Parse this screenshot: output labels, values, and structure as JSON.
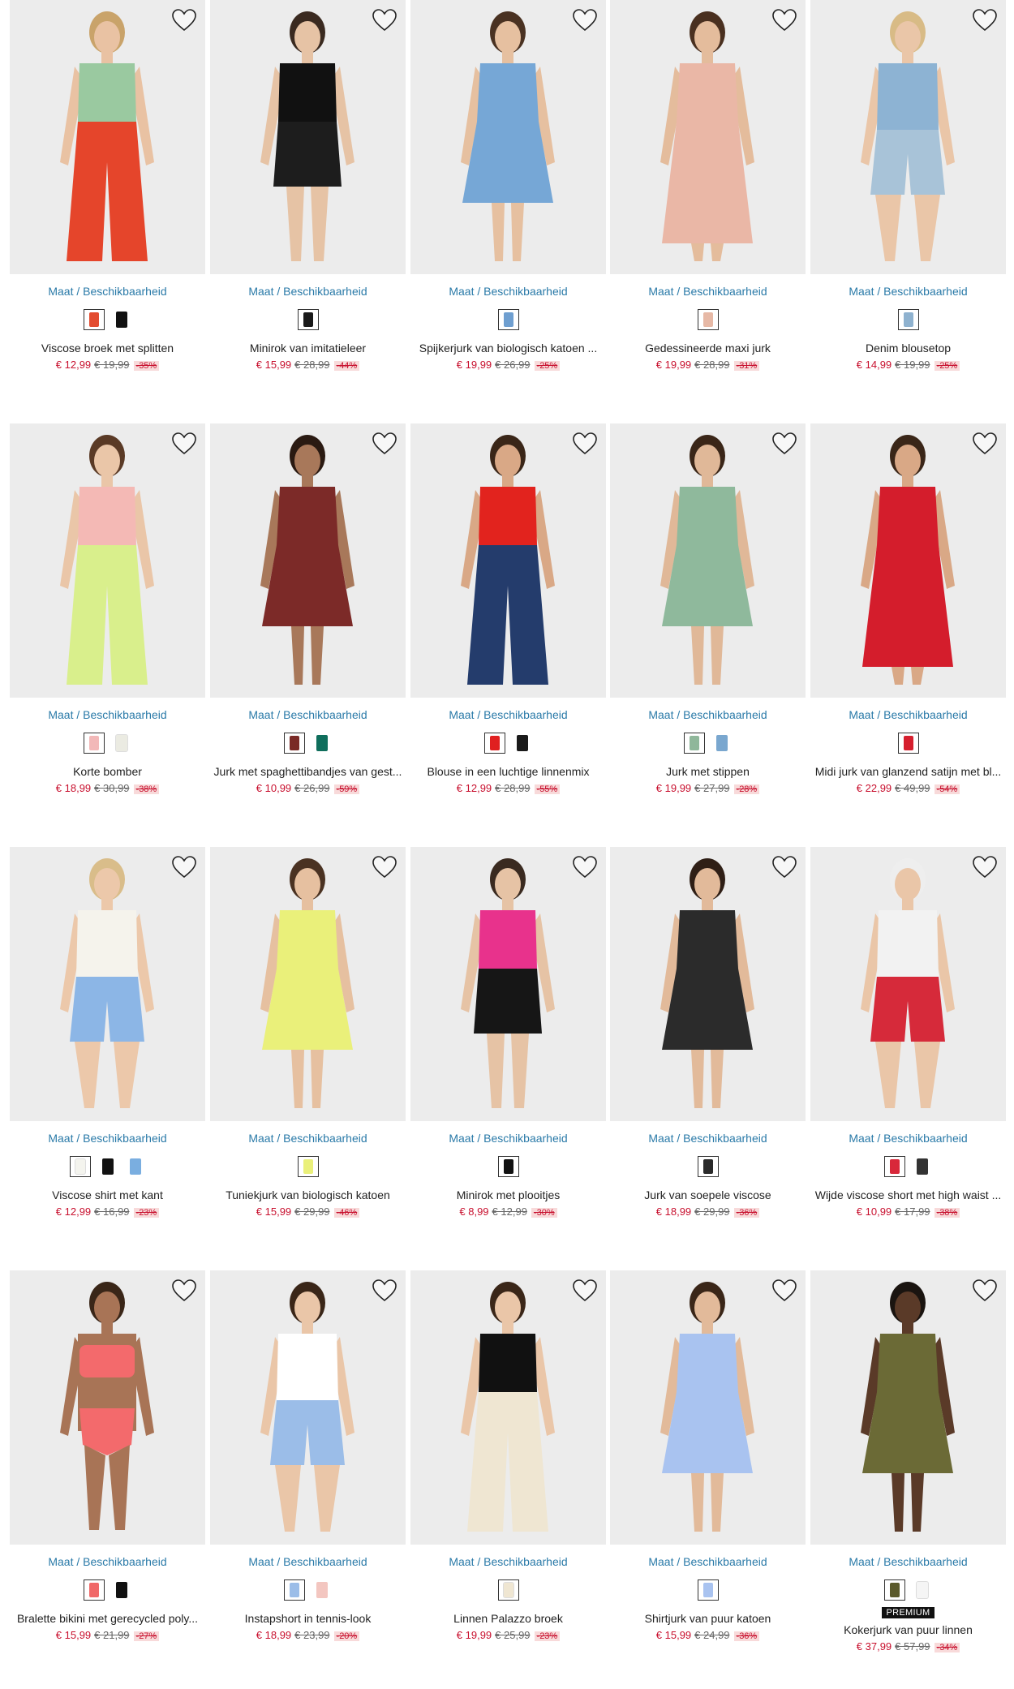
{
  "size_link_label": "Maat / Beschikbaarheid",
  "products": [
    {
      "name": "Viscose broek met splitten",
      "price": "€ 12,99",
      "old_price": "€ 19,99",
      "discount": "-35%",
      "swatches": [
        "#e34b2f",
        "#111111"
      ],
      "badge": "",
      "figure": {
        "top": "#9ac9a0",
        "bottom": "#e5452b",
        "skin": "#e9c2a3",
        "hair": "#c9a36a",
        "style": "pants"
      }
    },
    {
      "name": "Minirok van imitatieleer",
      "price": "€ 15,99",
      "old_price": "€ 28,99",
      "discount": "-44%",
      "swatches": [
        "#1a1a1a"
      ],
      "badge": "",
      "figure": {
        "top": "#111111",
        "bottom": "#1d1d1d",
        "skin": "#e6c3a5",
        "hair": "#3a2a20",
        "style": "skirt"
      }
    },
    {
      "name": "Spijkerjurk van biologisch katoen ...",
      "price": "€ 19,99",
      "old_price": "€ 26,99",
      "discount": "-25%",
      "swatches": [
        "#6f9fd0"
      ],
      "badge": "",
      "figure": {
        "top": "#76a7d6",
        "bottom": "#76a7d6",
        "skin": "#e6c0a0",
        "hair": "#4a3222",
        "style": "dress"
      }
    },
    {
      "name": "Gedessineerde maxi jurk",
      "price": "€ 19,99",
      "old_price": "€ 28,99",
      "discount": "-31%",
      "swatches": [
        "#e7b9a6"
      ],
      "badge": "",
      "figure": {
        "top": "#eab7a6",
        "bottom": "#e8c4b4",
        "skin": "#e4bc9c",
        "hair": "#4a3020",
        "style": "maxi"
      }
    },
    {
      "name": "Denim blousetop",
      "price": "€ 14,99",
      "old_price": "€ 19,99",
      "discount": "-25%",
      "swatches": [
        "#8fb2cf"
      ],
      "badge": "",
      "figure": {
        "top": "#8db3d3",
        "bottom": "#a8c3d8",
        "skin": "#eac6a8",
        "hair": "#d8bb86",
        "style": "shorts"
      }
    },
    {
      "name": "Korte bomber",
      "price": "€ 18,99",
      "old_price": "€ 30,99",
      "discount": "-38%",
      "swatches": [
        "#f2b8b8",
        "#ebebe2"
      ],
      "badge": "",
      "figure": {
        "top": "#f4b9b5",
        "bottom": "#d9ef8c",
        "skin": "#eac6a8",
        "hair": "#5a3a26",
        "style": "pants"
      }
    },
    {
      "name": "Jurk met spaghettibandjes van gest...",
      "price": "€ 10,99",
      "old_price": "€ 26,99",
      "discount": "-59%",
      "swatches": [
        "#7a2a26",
        "#0f6e5c"
      ],
      "badge": "",
      "figure": {
        "top": "#7c2a28",
        "bottom": "#7c2a28",
        "skin": "#a8785a",
        "hair": "#2a1a12",
        "style": "dress"
      }
    },
    {
      "name": "Blouse in een luchtige linnenmix",
      "price": "€ 12,99",
      "old_price": "€ 28,99",
      "discount": "-55%",
      "swatches": [
        "#e02020",
        "#1a1a1a"
      ],
      "badge": "",
      "figure": {
        "top": "#e2231e",
        "bottom": "#243c6c",
        "skin": "#d9a886",
        "hair": "#3a2618",
        "style": "pants"
      }
    },
    {
      "name": "Jurk met stippen",
      "price": "€ 19,99",
      "old_price": "€ 27,99",
      "discount": "-28%",
      "swatches": [
        "#8fb79a",
        "#7aa7cf"
      ],
      "badge": "",
      "figure": {
        "top": "#8fb99c",
        "bottom": "#8fb99c",
        "skin": "#e0b898",
        "hair": "#3a2618",
        "style": "dress"
      }
    },
    {
      "name": "Midi jurk van glanzend satijn met bl...",
      "price": "€ 22,99",
      "old_price": "€ 49,99",
      "discount": "-54%",
      "swatches": [
        "#d61f2e"
      ],
      "badge": "",
      "figure": {
        "top": "#d41d2c",
        "bottom": "#d41d2c",
        "skin": "#d9a886",
        "hair": "#3a2618",
        "style": "maxi"
      }
    },
    {
      "name": "Viscose shirt met kant",
      "price": "€ 12,99",
      "old_price": "€ 16,99",
      "discount": "-23%",
      "swatches": [
        "#f4f4ee",
        "#111111",
        "#7aaee0"
      ],
      "badge": "",
      "figure": {
        "top": "#f5f3ec",
        "bottom": "#8cb6e6",
        "skin": "#ecc8aa",
        "hair": "#d9bd8a",
        "style": "shorts"
      }
    },
    {
      "name": "Tuniekjurk van biologisch katoen",
      "price": "€ 15,99",
      "old_price": "€ 29,99",
      "discount": "-46%",
      "swatches": [
        "#eaf07a"
      ],
      "badge": "",
      "figure": {
        "top": "#eaf07a",
        "bottom": "#eaf07a",
        "skin": "#e6c0a0",
        "hair": "#4a3222",
        "style": "dress"
      }
    },
    {
      "name": "Minirok met plooitjes",
      "price": "€ 8,99",
      "old_price": "€ 12,99",
      "discount": "-30%",
      "swatches": [
        "#111111"
      ],
      "badge": "",
      "figure": {
        "top": "#e8328c",
        "bottom": "#161616",
        "skin": "#e6c3a5",
        "hair": "#3a2a20",
        "style": "skirt"
      }
    },
    {
      "name": "Jurk van soepele viscose",
      "price": "€ 18,99",
      "old_price": "€ 29,99",
      "discount": "-36%",
      "swatches": [
        "#2a2a2a"
      ],
      "badge": "",
      "figure": {
        "top": "#2b2b2b",
        "bottom": "#e9e4d6",
        "skin": "#e2ba9a",
        "hair": "#2f1f16",
        "style": "dress"
      }
    },
    {
      "name": "Wijde viscose short met high waist ...",
      "price": "€ 10,99",
      "old_price": "€ 17,99",
      "discount": "-38%",
      "swatches": [
        "#d8283a",
        "#333333"
      ],
      "badge": "",
      "figure": {
        "top": "#f2f2f2",
        "bottom": "#d62a3a",
        "skin": "#eac6a8",
        "hair": "#eeeeee",
        "style": "shorts"
      }
    },
    {
      "name": "Bralette bikini met gerecycled poly...",
      "price": "€ 15,99",
      "old_price": "€ 21,99",
      "discount": "-27%",
      "swatches": [
        "#f06868",
        "#111111"
      ],
      "badge": "",
      "figure": {
        "top": "#f36a6c",
        "bottom": "#f36a6c",
        "skin": "#a87456",
        "hair": "#3a2618",
        "style": "bikini"
      }
    },
    {
      "name": "Instapshort in tennis-look",
      "price": "€ 18,99",
      "old_price": "€ 23,99",
      "discount": "-20%",
      "swatches": [
        "#9bbde8",
        "#f3c6c0"
      ],
      "badge": "",
      "figure": {
        "top": "#ffffff",
        "bottom": "#9bbde8",
        "skin": "#eac6a8",
        "hair": "#3a2618",
        "style": "shorts"
      }
    },
    {
      "name": "Linnen Palazzo broek",
      "price": "€ 19,99",
      "old_price": "€ 25,99",
      "discount": "-23%",
      "swatches": [
        "#efe6d2"
      ],
      "badge": "",
      "figure": {
        "top": "#111111",
        "bottom": "#efe6d2",
        "skin": "#eac6a8",
        "hair": "#3a2618",
        "style": "pants"
      }
    },
    {
      "name": "Shirtjurk van puur katoen",
      "price": "€ 15,99",
      "old_price": "€ 24,99",
      "discount": "-36%",
      "swatches": [
        "#a9c3f0"
      ],
      "badge": "",
      "figure": {
        "top": "#a9c3f0",
        "bottom": "#a9c3f0",
        "skin": "#e2ba9a",
        "hair": "#3a2618",
        "style": "dress"
      }
    },
    {
      "name": "Kokerjurk van puur linnen",
      "price": "€ 37,99",
      "old_price": "€ 57,99",
      "discount": "-34%",
      "swatches": [
        "#5b5a2c",
        "#f5f5f5"
      ],
      "badge": "PREMIUM",
      "figure": {
        "top": "#6b6a36",
        "bottom": "#6b6a36",
        "skin": "#5a3a28",
        "hair": "#1a1410",
        "style": "dress"
      }
    }
  ]
}
